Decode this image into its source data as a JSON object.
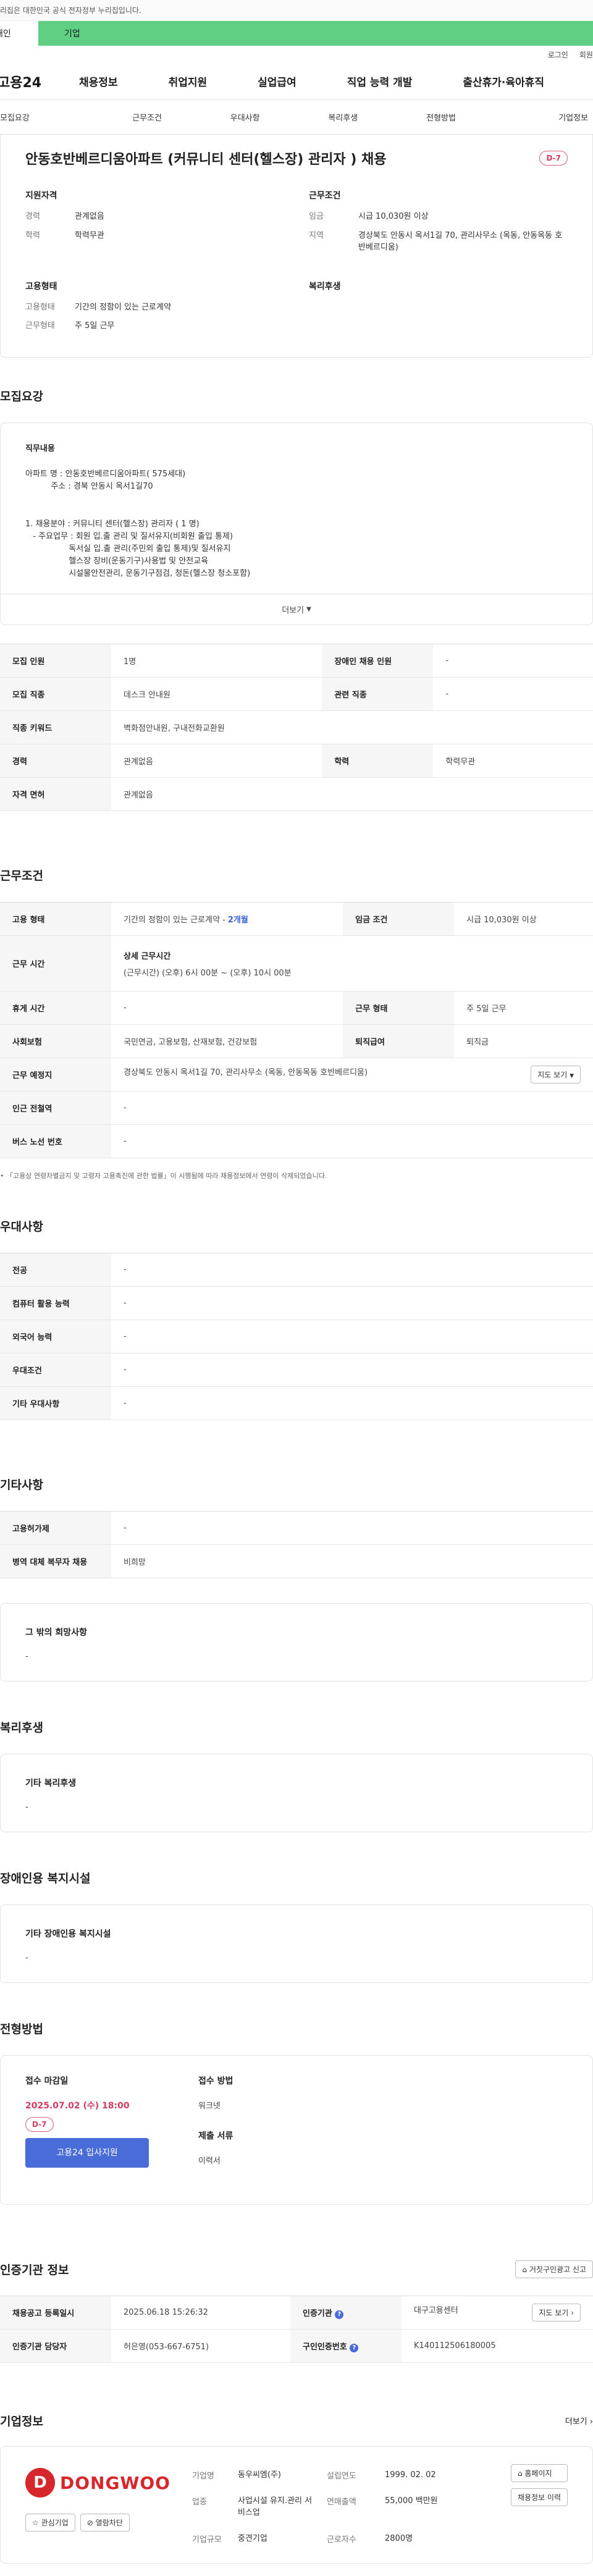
{
  "gov_banner": "이 누리집은 대한민국 공식 전자정부 누리집입니다.",
  "audience": {
    "person": "개인",
    "company": "기업"
  },
  "util": {
    "login": "로그인",
    "join": "회원가입"
  },
  "logo": "고용24",
  "gnb": [
    "채용정보",
    "취업지원",
    "실업급여",
    "직업 능력 개발",
    "출산휴가·육아휴직"
  ],
  "anchors": [
    "모집요강",
    "근무조건",
    "우대사항",
    "복리후생",
    "전형방법",
    "기업정보"
  ],
  "job": {
    "title": "안동호반베르디움아파트 (커뮤니티 센터(헬스장) 관리자 ) 채용",
    "dday": "D-7",
    "qualification": {
      "heading": "지원자격",
      "career_k": "경력",
      "career_v": "관계없음",
      "edu_k": "학력",
      "edu_v": "학력무관"
    },
    "condition": {
      "heading": "근무조건",
      "wage_k": "임금",
      "wage_v": "시급 10,030원 이상",
      "area_k": "지역",
      "area_v": "경상북도 안동시 옥서1길 70, 관리사무소 (옥동, 안동옥동 호반베르디움)"
    },
    "employment": {
      "heading": "고용형태",
      "type_k": "고용형태",
      "type_v": "기간의 정함이 있는 근로계약",
      "days_k": "근무형태",
      "days_v": "주 5일 근무"
    },
    "welfare": {
      "heading": "복리후생"
    }
  },
  "recruit": {
    "title": "모집요강",
    "duty_heading": "직무내용",
    "duty_text": "아파트 명 : 안동호반베르디움아파트( 575세대)\n          주소 : 경북 안동시 옥서1길70\n\n\n1. 채용분야 : 커뮤니티 센터(헬스장) 관리자 ( 1 명)\n   - 주요업무 : 회원 입.출 관리 및 질서유지(비회원 출입 통제)\n                 독서실 입.출 관리(주민외 출입 통제)및 질서유지\n                 헬스장 장비(운동기구)사용법 및 안전교육\n                 시설물안전관리, 운동기구점검, 청돈(헬스장 청소포함)",
    "more": "더보기",
    "table": [
      [
        "모집 인원",
        "1명",
        "장애인 채용 인원",
        "-"
      ],
      [
        "모집 직종",
        "데스크 안내원",
        "관련 직종",
        "-"
      ],
      [
        "직종 키워드",
        "벽화점안내원, 구내전화교환원"
      ],
      [
        "경력",
        "관계없음",
        "학력",
        "학력무관"
      ],
      [
        "자격 면허",
        "관계없음"
      ]
    ]
  },
  "work": {
    "title": "근무조건",
    "type_th": "고용 형태",
    "type_v": "기간의 정함이 있는 근로계약 - ",
    "type_months": "2개월",
    "wage_th": "임금 조건",
    "wage_v": "시급 10,030원 이상",
    "hours_th": "근무 시간",
    "hours_head": "상세 근무시간",
    "hours_v": "(근무시간) (오후) 6시 00분 ~ (오후) 10시 00분",
    "holiday_th": "휴게 시간",
    "holiday_v": "-",
    "shift_th": "근무 형태",
    "shift_v": "주 5일 근무",
    "insurance_th": "사회보험",
    "insurance_v": "국민연금, 고용보험, 산재보험, 건강보험",
    "severance_th": "퇴직급여",
    "severance_v": "퇴직금",
    "place_th": "근무 예정지",
    "place_v": "경상북도 안동시 옥서1길 70, 관리사무소 (옥동, 안동옥동 호반베르디움)",
    "map_btn": "지도 보기",
    "station_th": "인근 전철역",
    "station_v": "-",
    "bus_th": "버스 노선 번호",
    "bus_v": "-",
    "footnote": "「고용상 연령차별금지 및 고령자 고용촉진에 관한 법률」이 시행됨에 따라 채용정보에서 연령이 삭제되었습니다."
  },
  "prefer": {
    "title": "우대사항",
    "rows": [
      [
        "전공",
        "-"
      ],
      [
        "컴퓨터 활용 능력",
        "-"
      ],
      [
        "외국어 능력",
        "-"
      ],
      [
        "우대조건",
        "-"
      ],
      [
        "기타 우대사항",
        "-"
      ]
    ]
  },
  "etc": {
    "title": "기타사항",
    "rows": [
      [
        "고용허가제",
        "-"
      ],
      [
        "병역 대체 복무자 채용",
        "비희망"
      ]
    ],
    "other_heading": "그 밖의 희망사항",
    "other_v": "-"
  },
  "benefit": {
    "title": "복리후생",
    "heading": "기타 복리후생",
    "v": "-"
  },
  "disabled": {
    "title": "장애인용 복지시설",
    "heading": "기타 장애인용 복지시설",
    "v": "-"
  },
  "process": {
    "title": "전형방법",
    "deadline_heading": "접수 마감일",
    "deadline": "2025.07.02 (수) 18:00",
    "dday": "D-7",
    "apply_btn": "고용24 입사지원",
    "method_heading": "접수 방법",
    "method_v": "워크넷",
    "docs_heading": "제출 서류",
    "docs_v": "이력서"
  },
  "cert": {
    "title": "인증기관 정보",
    "report_btn": "거짓구인광고 신고",
    "rows": [
      [
        "채용공고 등록일시",
        "2025.06.18 15:26:32",
        "인증기관",
        "대구고용센터"
      ],
      [
        "인증기관 담당자",
        "허은영(053-667-6751)",
        "구인인증번호",
        "K140112506180005"
      ]
    ],
    "map_btn": "지도 보기"
  },
  "company": {
    "title": "기업정보",
    "more": "더보기",
    "logo_letter": "D",
    "logo_text": "DONGWOO",
    "interest_btn": "관심기업",
    "block_btn": "열람차단",
    "name_k": "기업명",
    "name_v": "동우씨엠(주)",
    "industry_k": "업종",
    "industry_v": "사업시설 유지.관리 서비스업",
    "size_k": "기업규모",
    "size_v": "중견기업",
    "founded_k": "설립연도",
    "founded_v": "1999. 02. 02",
    "sales_k": "연매출액",
    "sales_v": "55,000 백만원",
    "staff_k": "근로자수",
    "staff_v": "2800명",
    "home_btn": "홈페이지",
    "history_btn": "채용정보 이력"
  }
}
